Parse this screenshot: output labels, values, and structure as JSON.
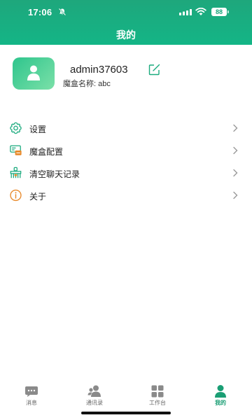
{
  "status": {
    "time": "17:06",
    "battery": "88"
  },
  "header": {
    "title": "我的"
  },
  "profile": {
    "username": "admin37603",
    "box_name": "魔盒名称: abc"
  },
  "menu": {
    "items": [
      {
        "label": "设置",
        "icon": "gear-icon"
      },
      {
        "label": "魔盒配置",
        "icon": "config-box-icon"
      },
      {
        "label": "清空聊天记录",
        "icon": "broom-icon"
      },
      {
        "label": "关于",
        "icon": "info-icon"
      }
    ]
  },
  "tabbar": {
    "tabs": [
      {
        "label": "消息",
        "icon": "chat-bubble-icon"
      },
      {
        "label": "通讯录",
        "icon": "contacts-icon"
      },
      {
        "label": "工作台",
        "icon": "workbench-grid-icon"
      },
      {
        "label": "我的",
        "icon": "person-icon"
      }
    ],
    "active_index": 3
  },
  "colors": {
    "accent": "#1aaa7d",
    "icon_orange": "#e8892a",
    "text": "#222222"
  }
}
